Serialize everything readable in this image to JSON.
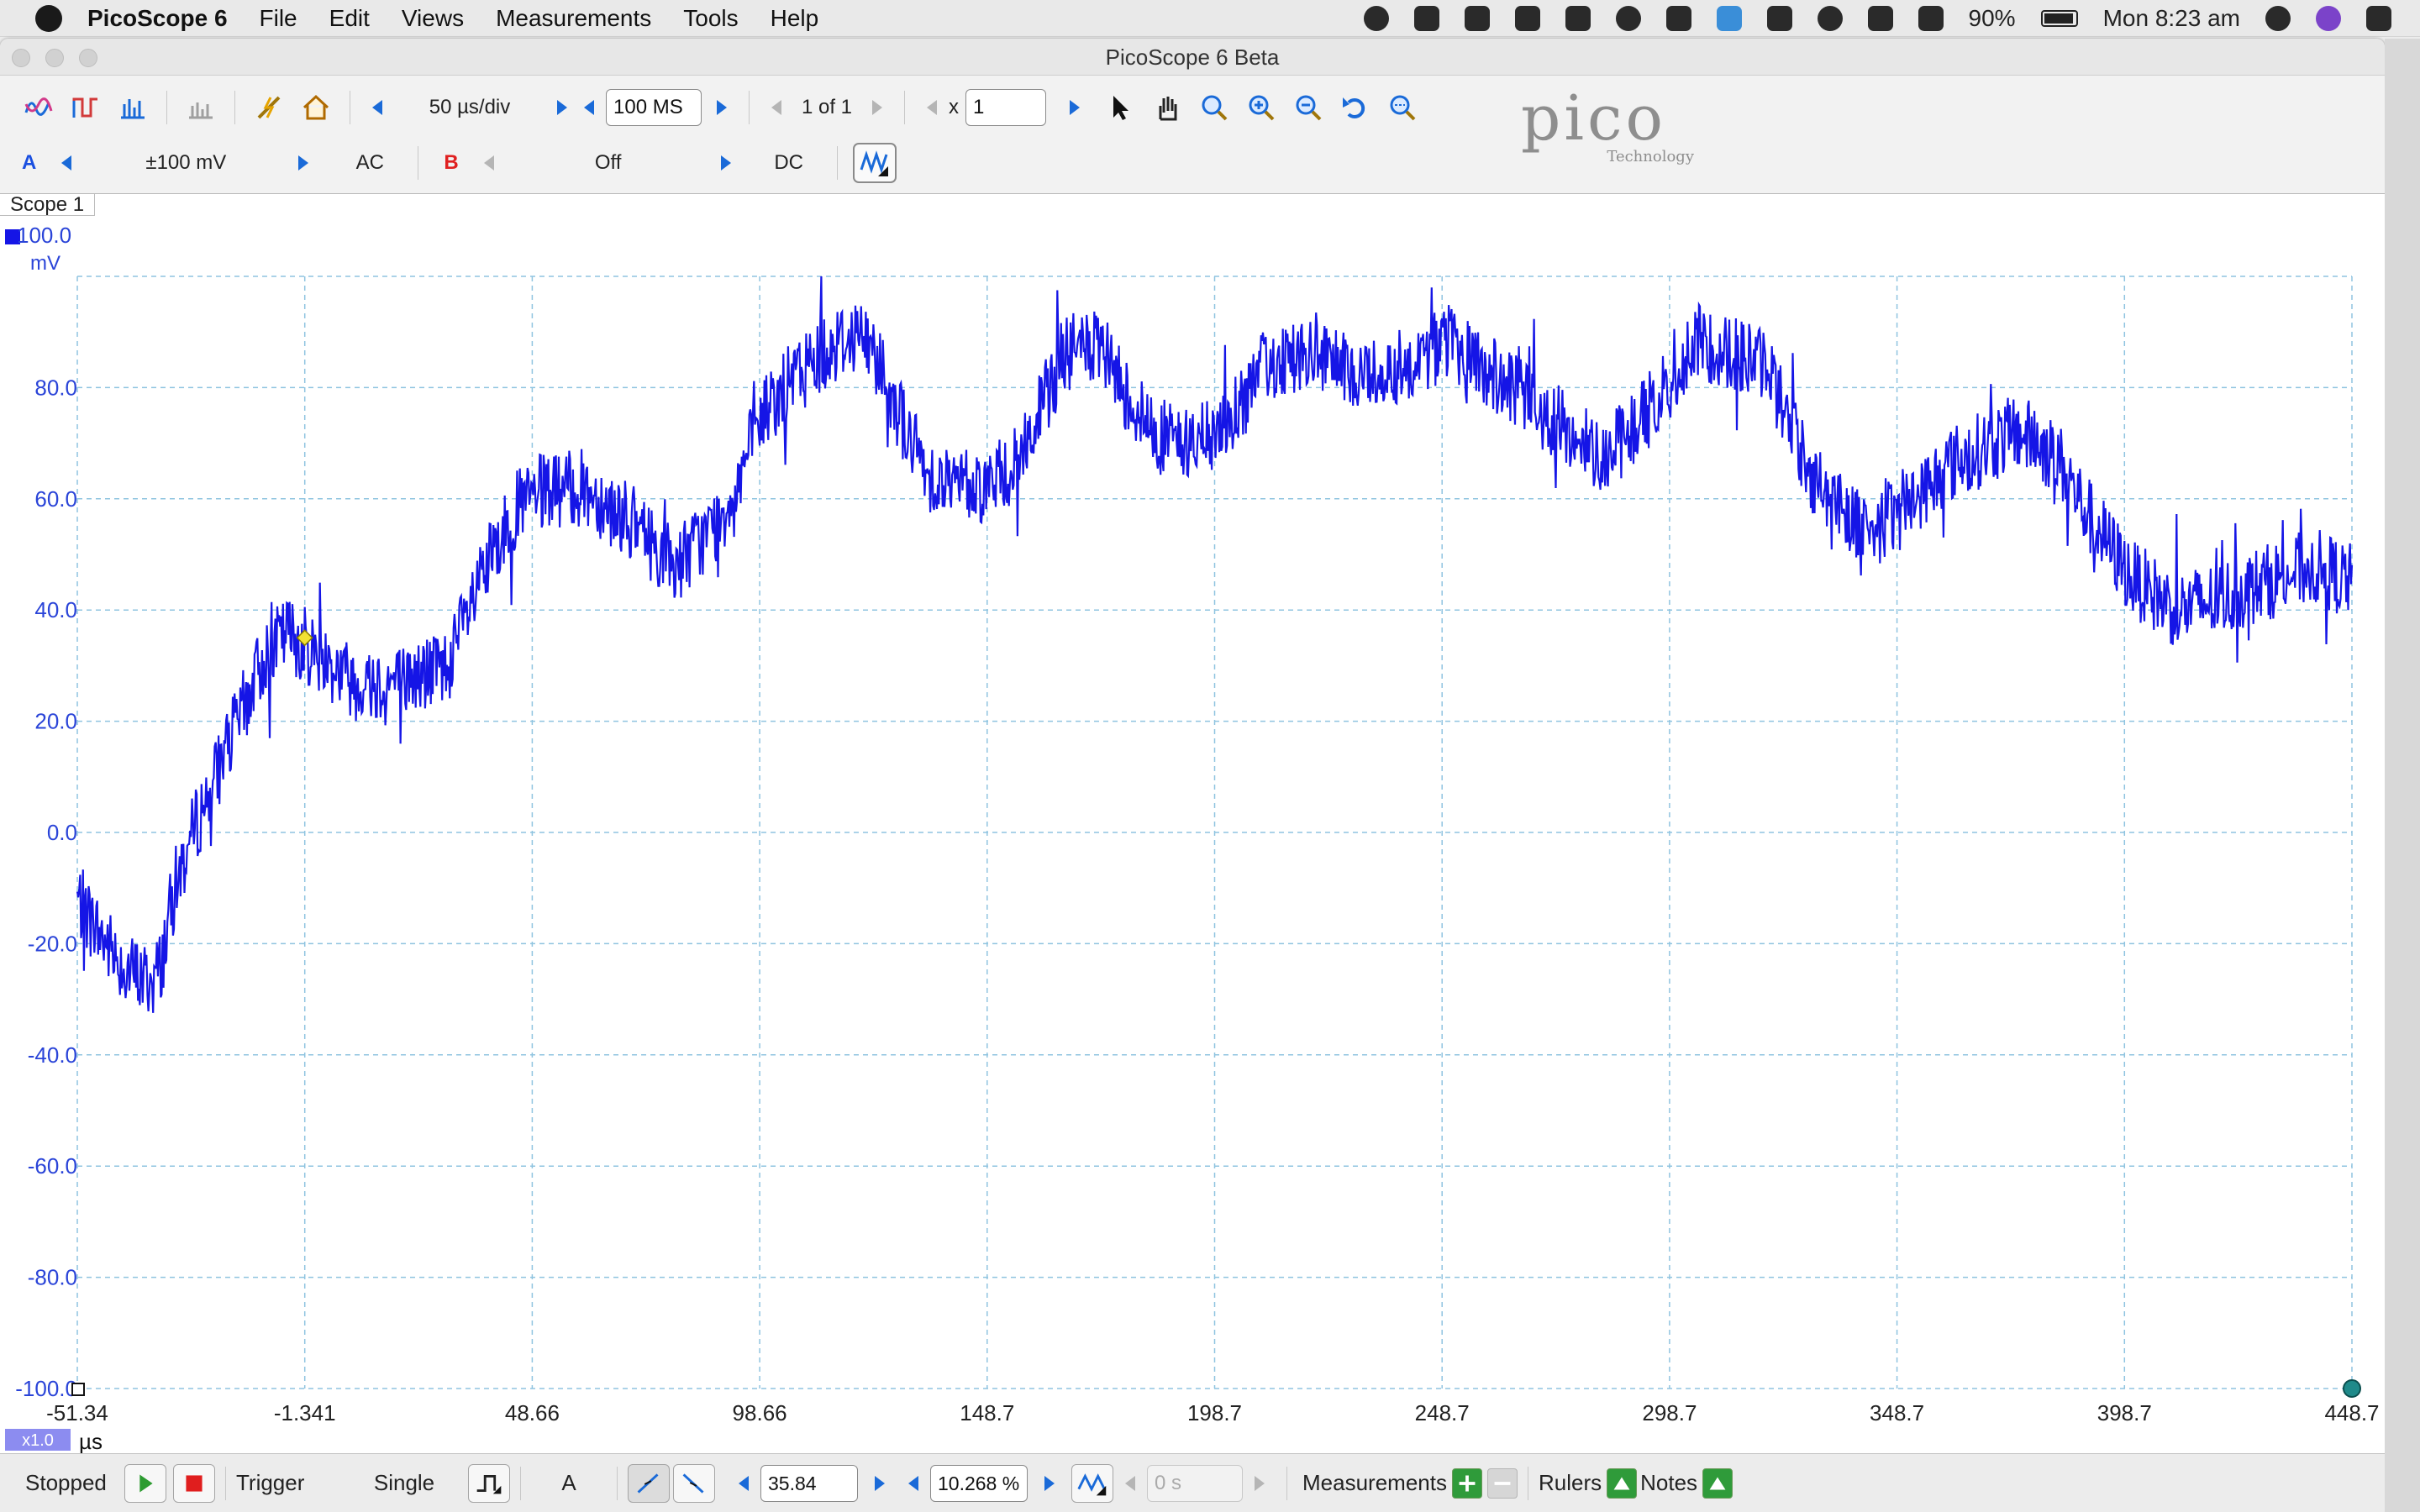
{
  "menubar": {
    "app": "PicoScope 6",
    "items": [
      "File",
      "Edit",
      "Views",
      "Measurements",
      "Tools",
      "Help"
    ],
    "battery": "90%",
    "clock": "Mon 8:23 am"
  },
  "window": {
    "title": "PicoScope 6 Beta"
  },
  "toolbar": {
    "timebase": "50 µs/div",
    "samples": "100 MS",
    "buffer": "1 of 1",
    "zoom_prefix": "x",
    "zoom_value": "1"
  },
  "channel_bar": {
    "a_label": "A",
    "a_range": "±100 mV",
    "a_coupling": "AC",
    "b_label": "B",
    "b_range": "Off",
    "b_coupling": "DC"
  },
  "logo": {
    "brand": "pico",
    "sub": "Technology"
  },
  "scope": {
    "tab": "Scope 1",
    "y_unit_top": "100.0",
    "y_unit": "mV",
    "x_unit": "µs",
    "x_scale_badge": "x1.0"
  },
  "chart_data": {
    "type": "line",
    "ylabel": "mV",
    "xlabel": "µs",
    "ylim": [
      -100,
      100
    ],
    "xlim": [
      -51.34,
      448.7
    ],
    "x_ticks": [
      "-51.34",
      "-1.341",
      "48.66",
      "98.66",
      "148.7",
      "198.7",
      "248.7",
      "298.7",
      "348.7",
      "398.7",
      "448.7"
    ],
    "y_ticks": [
      "100.0",
      "80.0",
      "60.0",
      "40.0",
      "20.0",
      "0.0",
      "-20.0",
      "-40.0",
      "-60.0",
      "-80.0",
      "-100.0"
    ],
    "grid": true,
    "series": [
      {
        "x": [
          -51.34,
          -45,
          -40,
          -35,
          -33,
          -30,
          -25,
          -20,
          -15,
          -10,
          -5,
          0,
          5,
          10,
          20,
          30,
          40,
          45,
          50,
          60,
          70,
          80,
          90,
          95,
          100,
          110,
          120,
          125,
          130,
          135,
          140,
          145,
          150,
          155,
          160,
          165,
          170,
          175,
          180,
          185,
          190,
          195,
          200,
          205,
          210,
          215,
          220,
          230,
          240,
          250,
          260,
          270,
          280,
          285,
          290,
          300,
          305,
          310,
          320,
          325,
          330,
          340,
          345,
          350,
          360,
          370,
          375,
          380,
          385,
          390,
          400,
          410,
          420,
          430,
          440,
          448.7
        ],
        "y": [
          -12,
          -20,
          -25,
          -27,
          -24,
          -10,
          2,
          12,
          22,
          32,
          36,
          33,
          30,
          27,
          27,
          30,
          50,
          58,
          61,
          62,
          56,
          48,
          56,
          66,
          76,
          85,
          90,
          85,
          74,
          65,
          63,
          62,
          63,
          66,
          75,
          85,
          88,
          85,
          78,
          72,
          70,
          70,
          72,
          78,
          84,
          86,
          85,
          82,
          84,
          88,
          82,
          76,
          70,
          68,
          72,
          82,
          88,
          87,
          84,
          74,
          64,
          56,
          55,
          58,
          66,
          70,
          72,
          70,
          66,
          58,
          46,
          40,
          42,
          45,
          48,
          45
        ]
      }
    ],
    "trigger_marker": {
      "x": -1.341,
      "y": 35
    }
  },
  "status": {
    "stopped": "Stopped",
    "trigger": "Trigger",
    "mode": "Single",
    "source": "A",
    "threshold": "35.84 mV",
    "pretrigger": "10.268 %",
    "delay": "0 s",
    "measurements": "Measurements",
    "rulers": "Rulers",
    "notes": "Notes"
  },
  "colors": {
    "trace": "#1515e6",
    "grid": "#8fc4e0",
    "axis_text": "#2a44d8"
  }
}
